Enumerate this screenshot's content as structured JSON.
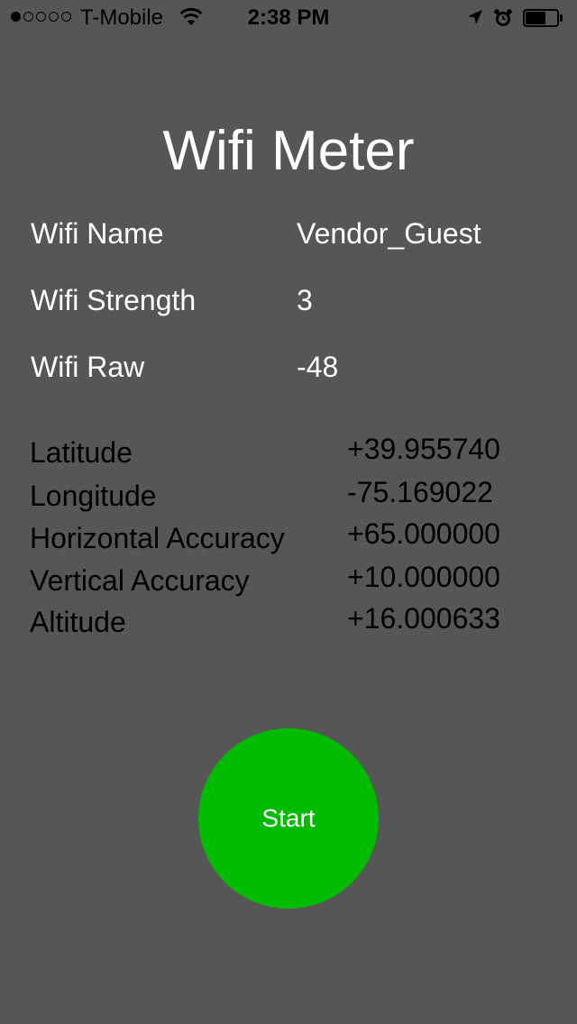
{
  "status_bar": {
    "carrier": "T-Mobile",
    "time": "2:38 PM",
    "signal_bars_filled": 1,
    "signal_bars_total": 5,
    "battery_level": 0.65,
    "icons": [
      "signal-dots",
      "wifi-icon",
      "location-arrow-icon",
      "alarm-clock-icon",
      "battery-icon"
    ]
  },
  "title": "Wifi Meter",
  "wifi": {
    "name_label": "Wifi Name",
    "name_value": "Vendor_Guest",
    "strength_label": "Wifi Strength",
    "strength_value": "3",
    "raw_label": "Wifi Raw",
    "raw_value": "-48"
  },
  "location": {
    "latitude_label": "Latitude",
    "latitude_value": "+39.955740",
    "longitude_label": "Longitude",
    "longitude_value": "-75.169022",
    "horizontal_accuracy_label": "Horizontal Accuracy",
    "horizontal_accuracy_value": "+65.000000",
    "vertical_accuracy_label": "Vertical Accuracy",
    "vertical_accuracy_value": "+10.000000",
    "altitude_label": "Altitude",
    "altitude_value": "+16.000633"
  },
  "start_button": {
    "label": "Start",
    "color": "#00bb00"
  },
  "colors": {
    "background": "#565656",
    "primary_text": "#ffffff",
    "secondary_text": "#000000"
  }
}
